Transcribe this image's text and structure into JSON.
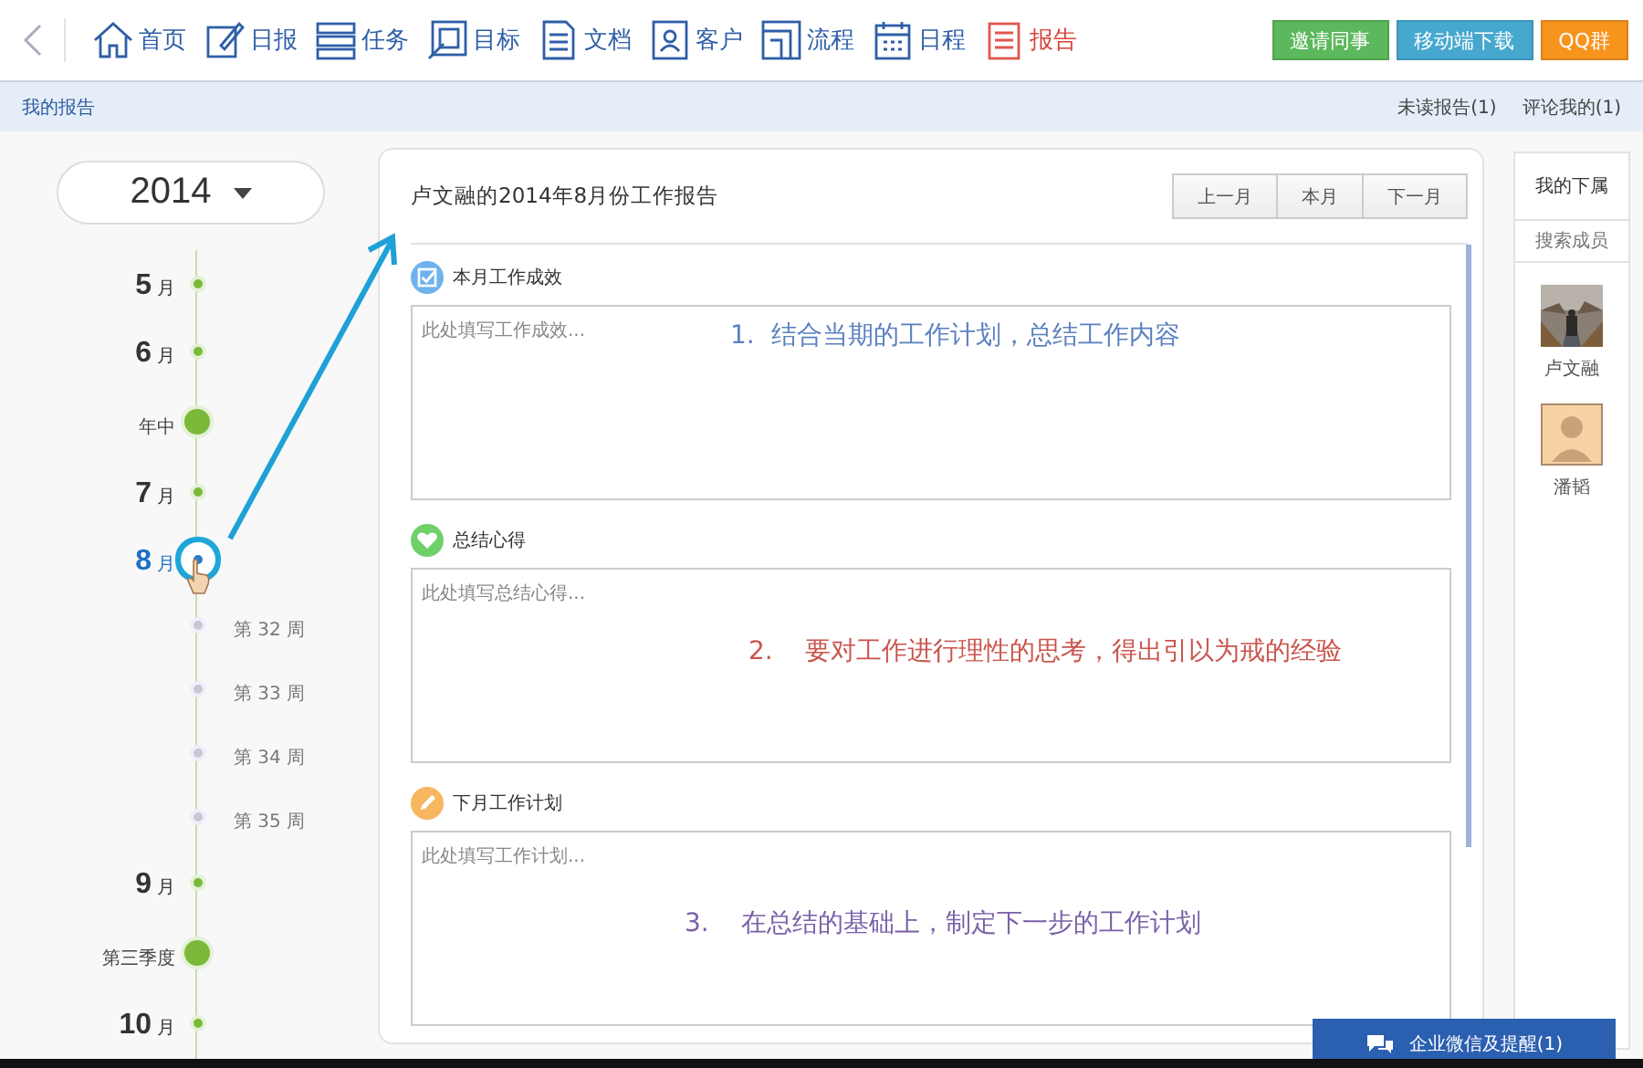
{
  "nav": {
    "items": [
      {
        "label": "首页",
        "selected": false
      },
      {
        "label": "日报",
        "selected": false
      },
      {
        "label": "任务",
        "selected": false
      },
      {
        "label": "目标",
        "selected": false
      },
      {
        "label": "文档",
        "selected": false
      },
      {
        "label": "客户",
        "selected": false
      },
      {
        "label": "流程",
        "selected": false
      },
      {
        "label": "日程",
        "selected": false
      },
      {
        "label": "报告",
        "selected": true
      }
    ],
    "buttons": [
      {
        "label": "邀请同事",
        "color": "#5cb85c"
      },
      {
        "label": "移动端下载",
        "color": "#46a8cf"
      },
      {
        "label": "QQ群",
        "color": "#f7941d"
      }
    ]
  },
  "subbar": {
    "title": "我的报告",
    "links": [
      "未读报告(1)",
      "评论我的(1)"
    ]
  },
  "timeline": {
    "year": "2014",
    "items": [
      {
        "kind": "month",
        "num": "5",
        "unit": "月",
        "selected": false
      },
      {
        "kind": "month",
        "num": "6",
        "unit": "月",
        "selected": false
      },
      {
        "kind": "milestone",
        "label": "年中"
      },
      {
        "kind": "month",
        "num": "7",
        "unit": "月",
        "selected": false
      },
      {
        "kind": "month",
        "num": "8",
        "unit": "月",
        "selected": true
      },
      {
        "kind": "week",
        "label": "第 32 周"
      },
      {
        "kind": "week",
        "label": "第 33 周"
      },
      {
        "kind": "week",
        "label": "第 34 周"
      },
      {
        "kind": "week",
        "label": "第 35 周"
      },
      {
        "kind": "month",
        "num": "9",
        "unit": "月",
        "selected": false
      },
      {
        "kind": "milestone",
        "label": "第三季度"
      },
      {
        "kind": "month",
        "num": "10",
        "unit": "月",
        "selected": false
      }
    ]
  },
  "report": {
    "title": "卢文融的2014年8月份工作报告",
    "period_buttons": [
      "上一月",
      "本月",
      "下一月"
    ],
    "sections": [
      {
        "kind": "check",
        "heading": "本月工作成效",
        "placeholder": "此处填写工作成效...",
        "note": "1.  结合当期的工作计划，总结工作内容",
        "color": "#5b80c0"
      },
      {
        "kind": "heart",
        "heading": "总结心得",
        "placeholder": "此处填写总结心得...",
        "note": "2.    要对工作进行理性的思考，得出引以为戒的经验",
        "color": "#c9554e"
      },
      {
        "kind": "pencil",
        "heading": "下月工作计划",
        "placeholder": "此处填写工作计划...",
        "note": "3.    在总结的基础上，制定下一步的工作计划",
        "color": "#7a61a8"
      }
    ]
  },
  "subordinates": {
    "title": "我的下属",
    "search_placeholder": "搜索成员",
    "members": [
      {
        "name": "卢文融",
        "kind": "picture"
      },
      {
        "name": "潘韬",
        "kind": "avatar"
      }
    ]
  },
  "chat_button": "企业微信及提醒(1)"
}
